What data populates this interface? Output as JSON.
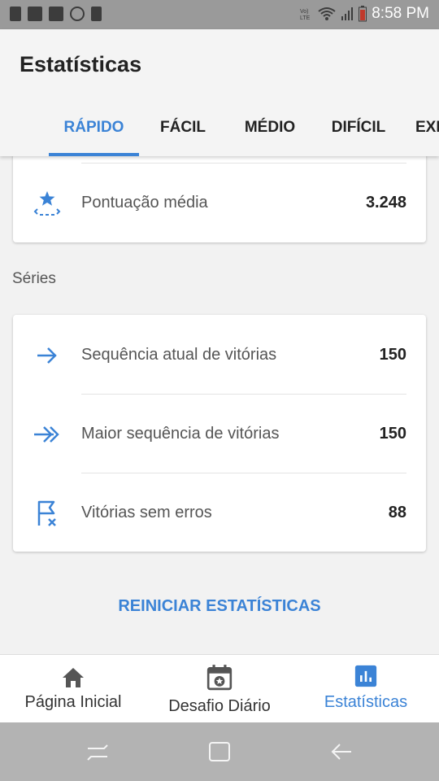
{
  "status_bar": {
    "time": "8:58 PM",
    "left_icons": [
      "sim-icon",
      "linkedin-icon",
      "image-icon",
      "sync-icon",
      "sd-card-icon"
    ],
    "right_icons": [
      "volte-icon",
      "wifi-icon",
      "signal-icon",
      "battery-icon"
    ]
  },
  "header": {
    "title": "Estatísticas",
    "tabs": [
      {
        "label": "RÁPIDO",
        "active": true
      },
      {
        "label": "FÁCIL",
        "active": false
      },
      {
        "label": "MÉDIO",
        "active": false
      },
      {
        "label": "DIFÍCIL",
        "active": false
      },
      {
        "label": "EXPERT",
        "active": false
      }
    ]
  },
  "card1": {
    "rows": [
      {
        "label": "Pontuação média",
        "value": "3.248",
        "icon": "star-score-icon"
      }
    ]
  },
  "series_section": {
    "title": "Séries",
    "rows": [
      {
        "label": "Sequência atual de vitórias",
        "value": "150",
        "icon": "arrow-right-icon"
      },
      {
        "label": "Maior sequência de vitórias",
        "value": "150",
        "icon": "double-arrow-right-icon"
      },
      {
        "label": "Vitórias sem erros",
        "value": "88",
        "icon": "flag-no-errors-icon"
      }
    ]
  },
  "reset_label": "REINICIAR ESTATÍSTICAS",
  "bottom_nav": [
    {
      "label": "Página Inicial",
      "icon": "home-icon",
      "active": false
    },
    {
      "label": "Desafio Diário",
      "icon": "calendar-star-icon",
      "active": false
    },
    {
      "label": "Estatísticas",
      "icon": "bar-chart-icon",
      "active": true
    }
  ],
  "colors": {
    "accent": "#3b83d6",
    "status_bar": "#9a9a9a",
    "system_nav": "#b3b3b3"
  }
}
